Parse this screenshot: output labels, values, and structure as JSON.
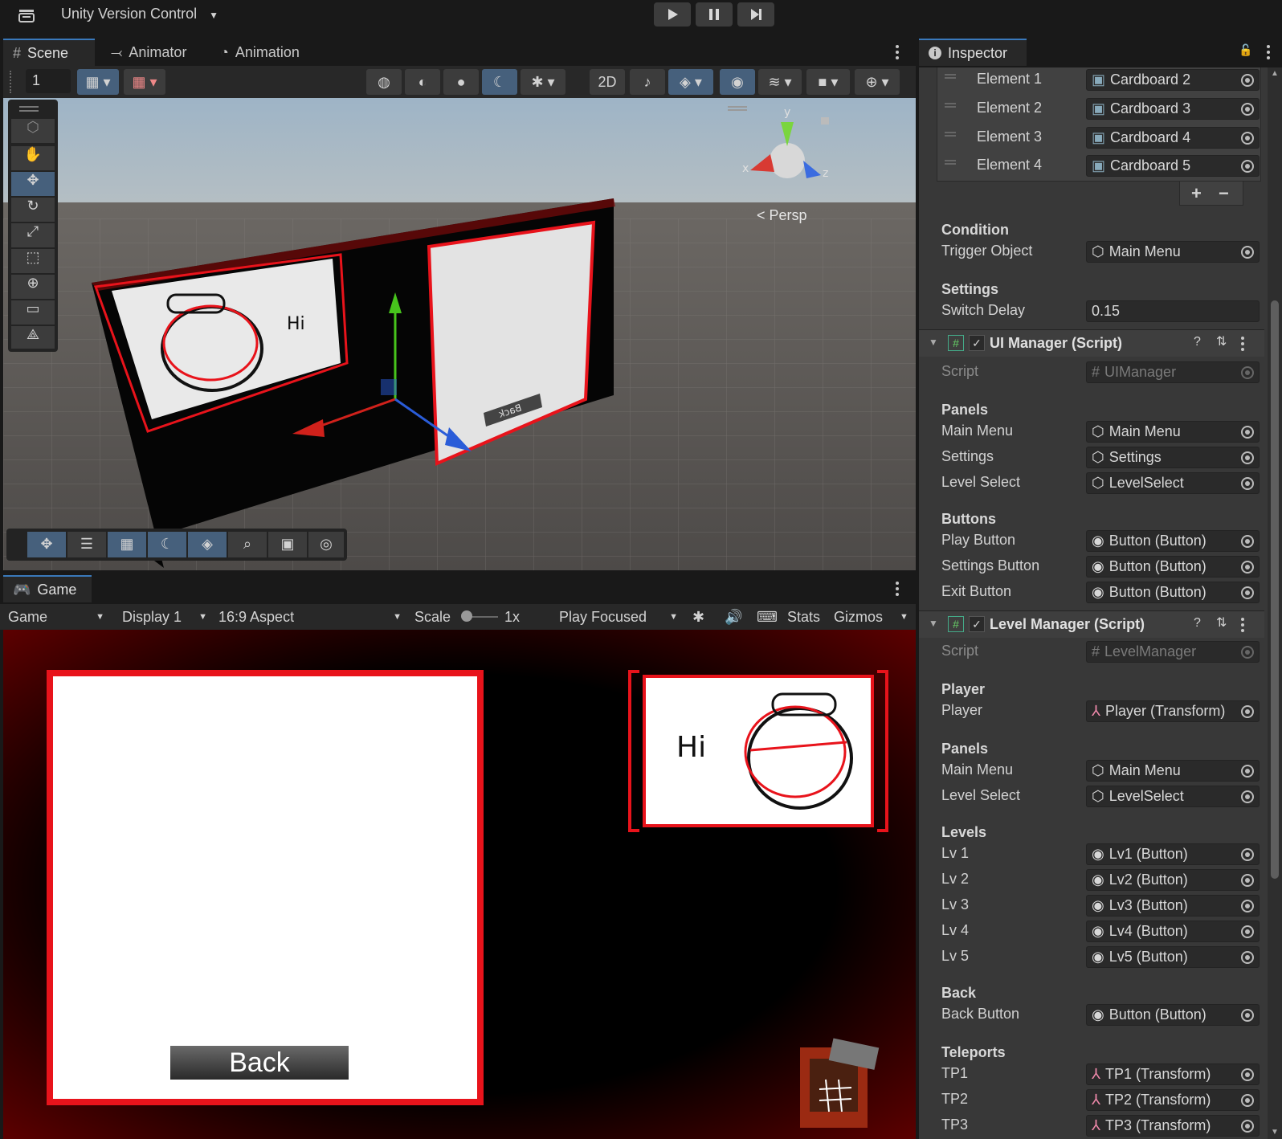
{
  "topbar": {
    "version_control": "Unity Version Control"
  },
  "tabs_top": [
    "Scene",
    "Animator",
    "Animation"
  ],
  "scene": {
    "grid_value": "1",
    "persp_label": "Persp",
    "gizmo_axes": {
      "x": "x",
      "y": "y",
      "z": "z"
    },
    "back_label": "Back",
    "hi_label": "Hi"
  },
  "inspector_tab": "Inspector",
  "game": {
    "tab": "Game",
    "toolbar": {
      "mode": "Game",
      "display": "Display 1",
      "aspect": "16:9 Aspect",
      "scale_label": "Scale",
      "scale_value": "1x",
      "play_mode": "Play Focused",
      "stats": "Stats",
      "gizmos": "Gizmos"
    },
    "back_button": "Back",
    "hi_label": "Hi"
  },
  "inspector": {
    "elements": [
      {
        "label": "Element 1",
        "value": "Cardboard 2"
      },
      {
        "label": "Element 2",
        "value": "Cardboard 3"
      },
      {
        "label": "Element 3",
        "value": "Cardboard 4"
      },
      {
        "label": "Element 4",
        "value": "Cardboard 5"
      }
    ],
    "list_add": "+",
    "list_remove": "−",
    "condition": {
      "header": "Condition",
      "label": "Trigger Object",
      "value": "Main Menu"
    },
    "settings": {
      "header": "Settings",
      "label": "Switch Delay",
      "value": "0.15"
    },
    "ui_manager": {
      "title": "UI Manager (Script)",
      "script_label": "Script",
      "script_value": "UIManager",
      "panels_header": "Panels",
      "panels": [
        {
          "label": "Main Menu",
          "value": "Main Menu"
        },
        {
          "label": "Settings",
          "value": "Settings"
        },
        {
          "label": "Level Select",
          "value": "LevelSelect"
        }
      ],
      "buttons_header": "Buttons",
      "buttons": [
        {
          "label": "Play Button",
          "value": "Button (Button)"
        },
        {
          "label": "Settings Button",
          "value": "Button (Button)"
        },
        {
          "label": "Exit Button",
          "value": "Button (Button)"
        }
      ]
    },
    "level_manager": {
      "title": "Level Manager (Script)",
      "script_label": "Script",
      "script_value": "LevelManager",
      "player_header": "Player",
      "player_label": "Player",
      "player_value": "Player (Transform)",
      "panels_header": "Panels",
      "panels": [
        {
          "label": "Main Menu",
          "value": "Main Menu"
        },
        {
          "label": "Level Select",
          "value": "LevelSelect"
        }
      ],
      "levels_header": "Levels",
      "levels": [
        {
          "label": "Lv 1",
          "value": "Lv1 (Button)"
        },
        {
          "label": "Lv 2",
          "value": "Lv2 (Button)"
        },
        {
          "label": "Lv 3",
          "value": "Lv3 (Button)"
        },
        {
          "label": "Lv 4",
          "value": "Lv4 (Button)"
        },
        {
          "label": "Lv 5",
          "value": "Lv5 (Button)"
        }
      ],
      "back_header": "Back",
      "back_label": "Back Button",
      "back_value": "Button (Button)",
      "teleports_header": "Teleports",
      "teleports": [
        {
          "label": "TP1",
          "value": "TP1 (Transform)"
        },
        {
          "label": "TP2",
          "value": "TP2 (Transform)"
        },
        {
          "label": "TP3",
          "value": "TP3 (Transform)"
        }
      ]
    }
  },
  "colors": {
    "accent": "#3a79bb",
    "panel": "#383838",
    "field": "#2a2a2a",
    "red": "#e8131b"
  }
}
